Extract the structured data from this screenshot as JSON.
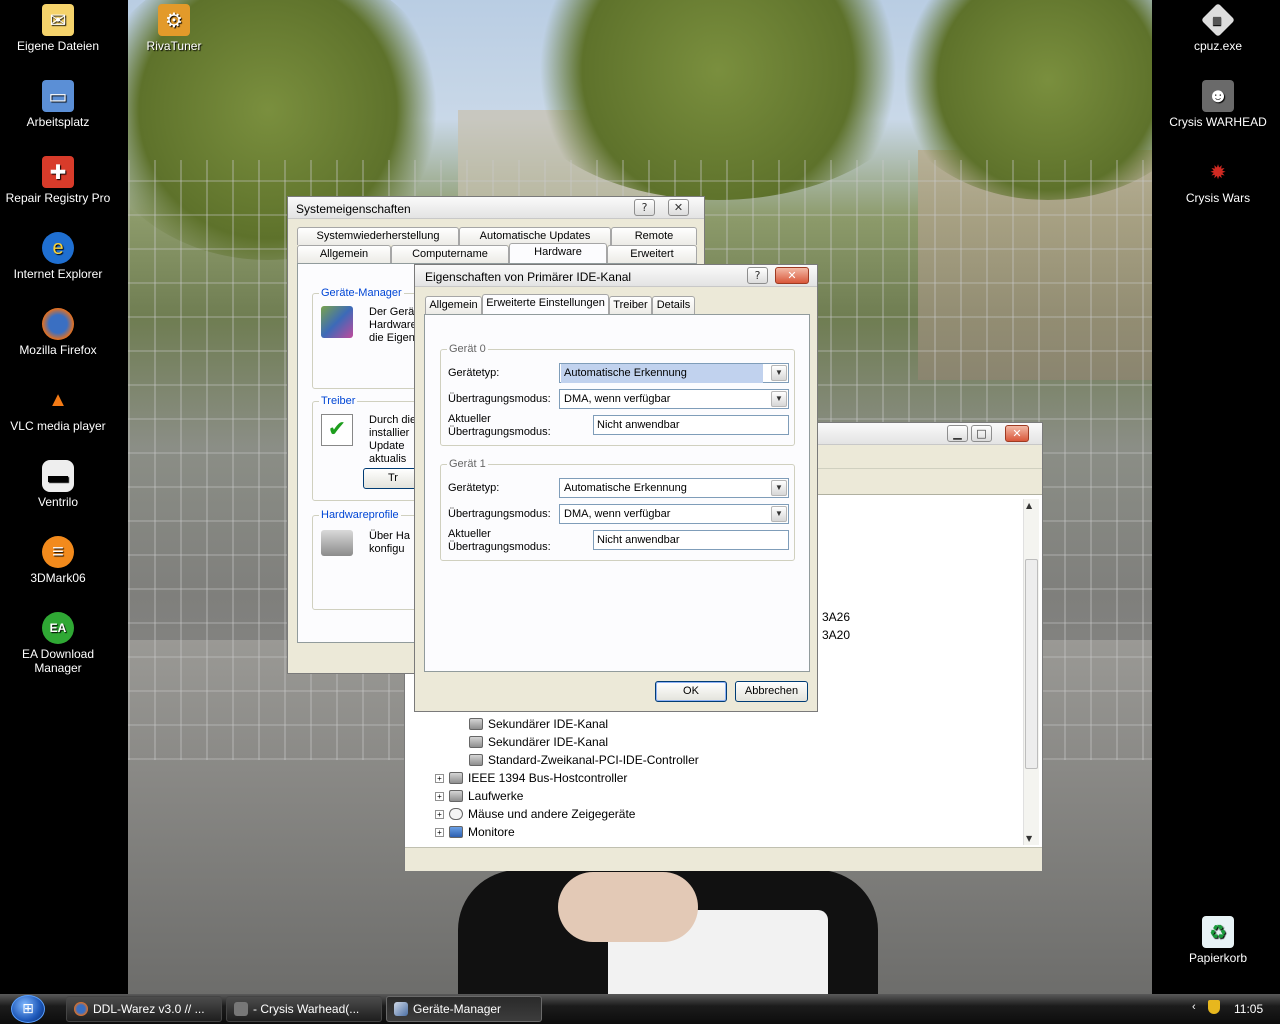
{
  "desktop": {
    "left_icons": [
      {
        "label": "Eigene Dateien",
        "icon": "my-documents-icon"
      },
      {
        "label": "Arbeitsplatz",
        "icon": "my-computer-icon"
      },
      {
        "label": "Repair Registry Pro",
        "icon": "repair-registry-icon"
      },
      {
        "label": "Internet Explorer",
        "icon": "internet-explorer-icon"
      },
      {
        "label": "Mozilla Firefox",
        "icon": "firefox-icon"
      },
      {
        "label": "VLC media player",
        "icon": "vlc-icon"
      },
      {
        "label": "Ventrilo",
        "icon": "ventrilo-icon"
      },
      {
        "label": "3DMark06",
        "icon": "3dmark-icon"
      },
      {
        "label": "EA Download Manager",
        "icon": "ea-icon"
      }
    ],
    "rivatuner_label": "RivaTuner",
    "right_icons": [
      {
        "label": "cpuz.exe",
        "icon": "cpuz-icon"
      },
      {
        "label": "Crysis WARHEAD",
        "icon": "crysis-warhead-icon"
      },
      {
        "label": "Crysis Wars",
        "icon": "crysis-wars-icon"
      },
      {
        "label": "Papierkorb",
        "icon": "recycle-bin-icon"
      }
    ]
  },
  "sysprops": {
    "title": "Systemeigenschaften",
    "tabs_row1": [
      "Systemwiederherstellung",
      "Automatische Updates",
      "Remote"
    ],
    "tabs_row2": [
      "Allgemein",
      "Computername",
      "Hardware",
      "Erweitert"
    ],
    "groups": {
      "geraete_manager": {
        "title": "Geräte-Manager",
        "text": "Der Gerät\nHardware\ndie Eigens"
      },
      "treiber": {
        "title": "Treiber",
        "text": "Durch die\ninstallier\nUpdate\naktualis",
        "button": "Tr"
      },
      "hardwareprofile": {
        "title": "Hardwareprofile",
        "text": "Über Ha\nkonfigu"
      }
    }
  },
  "devmgr": {
    "tree_visible": [
      {
        "label": "Sekundärer IDE-Kanal",
        "level": 2
      },
      {
        "label": "Sekundärer IDE-Kanal",
        "level": 2
      },
      {
        "label": "Standard-Zweikanal-PCI-IDE-Controller",
        "level": 2
      },
      {
        "label": "IEEE 1394 Bus-Hostcontroller",
        "level": 1
      },
      {
        "label": "Laufwerke",
        "level": 1
      },
      {
        "label": "Mäuse und andere Zeigegeräte",
        "level": 1
      },
      {
        "label": "Monitore",
        "level": 1
      }
    ],
    "partial_codes": [
      "3A26",
      "3A20"
    ],
    "expand_symbol": "+"
  },
  "ide_dialog": {
    "title": "Eigenschaften von Primärer IDE-Kanal",
    "tabs": [
      "Allgemein",
      "Erweiterte Einstellungen",
      "Treiber",
      "Details"
    ],
    "device0": {
      "title": "Gerät 0",
      "type_label": "Gerätetyp:",
      "type_value": "Automatische Erkennung",
      "mode_label": "Übertragungsmodus:",
      "mode_value": "DMA, wenn verfügbar",
      "current_label_1": "Aktueller",
      "current_label_2": "Übertragungsmodus:",
      "current_value": "Nicht anwendbar"
    },
    "device1": {
      "title": "Gerät 1",
      "type_label": "Gerätetyp:",
      "type_value": "Automatische Erkennung",
      "mode_label": "Übertragungsmodus:",
      "mode_value": "DMA, wenn verfügbar",
      "current_label_1": "Aktueller",
      "current_label_2": "Übertragungsmodus:",
      "current_value": "Nicht anwendbar"
    },
    "ok": "OK",
    "cancel": "Abbrechen"
  },
  "taskbar": {
    "tasks": [
      {
        "label": "DDL-Warez v3.0 // ...",
        "icon": "firefox-icon"
      },
      {
        "label": "- Crysis Warhead(...",
        "icon": "crysis-warhead-icon"
      },
      {
        "label": "Geräte-Manager",
        "icon": "device-manager-icon"
      }
    ],
    "clock": "11:05"
  },
  "colors": {
    "accent": "#0046d5",
    "taskbar": "#1c1c1c",
    "dialog_bg": "#ece9d8"
  }
}
